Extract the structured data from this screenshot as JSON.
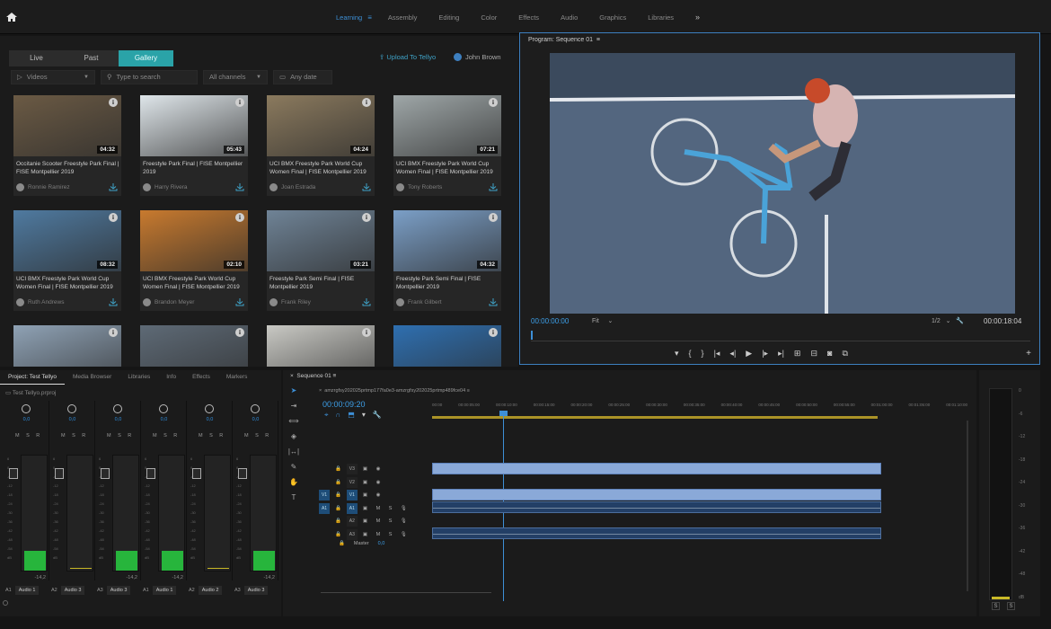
{
  "workspace_tabs": [
    {
      "label": "Learning",
      "active": true
    },
    {
      "label": "Assembly"
    },
    {
      "label": "Editing"
    },
    {
      "label": "Color"
    },
    {
      "label": "Effects"
    },
    {
      "label": "Audio"
    },
    {
      "label": "Graphics"
    },
    {
      "label": "Libraries"
    }
  ],
  "media": {
    "subtabs": [
      "Live",
      "Past",
      "Gallery"
    ],
    "active_subtab": "Gallery",
    "upload_label": "Upload To Tellyo",
    "user_name": "John Brown",
    "filters": {
      "type": "Videos",
      "search_placeholder": "Type to search",
      "channels": "All channels",
      "date": "Any date"
    },
    "cards": [
      {
        "title": "Occitanie Scooter Freestyle Park Final | FISE Montpellier 2019",
        "author": "Ronnie Ramirez",
        "duration": "04:32",
        "thumb": "#6b5a44"
      },
      {
        "title": "Freestyle Park Final | FISE Montpellier 2019",
        "author": "Harry Rivera",
        "duration": "05:43",
        "thumb": "#dfe6ea"
      },
      {
        "title": "UCI BMX Freestyle Park World Cup Women Final | FISE Montpellier 2019",
        "author": "Joan Estrada",
        "duration": "04:24",
        "thumb": "#8b7a5e"
      },
      {
        "title": "UCI BMX Freestyle Park World Cup Women Final | FISE Montpellier 2019",
        "author": "Tony Roberts",
        "duration": "07:21",
        "thumb": "#9fa7a8"
      },
      {
        "title": "UCI BMX Freestyle Park World Cup Women Final | FISE Montpellier 2019",
        "author": "Ruth Andrews",
        "duration": "08:32",
        "thumb": "#4f7aa0"
      },
      {
        "title": "UCI BMX Freestyle Park World Cup Women Final | FISE Montpellier 2019",
        "author": "Brandon Meyer",
        "duration": "02:10",
        "thumb": "#c87a2e"
      },
      {
        "title": "Freestyle Park Semi Final | FISE Montpellier 2019",
        "author": "Frank Riley",
        "duration": "03:21",
        "thumb": "#6f8396"
      },
      {
        "title": "Freestyle Park Semi Final | FISE Montpellier 2019",
        "author": "Frank Gilbert",
        "duration": "04:32",
        "thumb": "#7b9fc7"
      },
      {
        "title": "",
        "author": "",
        "duration": "",
        "thumb": "#8fa2b5"
      },
      {
        "title": "",
        "author": "",
        "duration": "",
        "thumb": "#5e6a76"
      },
      {
        "title": "",
        "author": "",
        "duration": "",
        "thumb": "#c9c9c4"
      },
      {
        "title": "",
        "author": "",
        "duration": "",
        "thumb": "#2e6fb0"
      }
    ]
  },
  "program": {
    "title": "Program: Sequence 01",
    "timecode_in": "00:00:00:00",
    "fit": "Fit",
    "resolution": "1/2",
    "timecode_out": "00:00:18:04",
    "frame_color": "#4f6580"
  },
  "bottom_tabs": [
    {
      "label": "Project: Test Tellyo",
      "active": true
    },
    {
      "label": "Media Browser"
    },
    {
      "label": "Libraries"
    },
    {
      "label": "Info"
    },
    {
      "label": "Effects"
    },
    {
      "label": "Markers"
    }
  ],
  "mixer": {
    "project_file": "Test Tellyo.prproj",
    "channels": [
      {
        "id": "A1",
        "name": "Audio 1",
        "db": "-14,2",
        "knob": "0,0"
      },
      {
        "id": "A2",
        "name": "Audio 3",
        "db": "",
        "knob": "0,0"
      },
      {
        "id": "A3",
        "name": "Audio 3",
        "db": "-14,2",
        "knob": "0,0"
      },
      {
        "id": "A1",
        "name": "Audio 1",
        "db": "-14,2",
        "knob": "0,0"
      },
      {
        "id": "A2",
        "name": "Audio 2",
        "db": "",
        "knob": "0,0"
      },
      {
        "id": "A3",
        "name": "Audio 3",
        "db": "-14,2",
        "knob": "0,0"
      }
    ],
    "scale": [
      "6",
      "0",
      "-6",
      "-12",
      "-18",
      "-24",
      "-30",
      "-36",
      "-42",
      "-48",
      "-54",
      "dB"
    ]
  },
  "timeline": {
    "tab": "Sequence 01",
    "sequence_name": "amzrgfsy202025prtmp177fa0e3-amzrgfsy202025prtmp489fce04",
    "timecode": "00:00:09:20",
    "ruler": [
      "00:00",
      "00:00:05:00",
      "00:00:10:00",
      "00:00:15:00",
      "00:00:20:00",
      "00:00:25:00",
      "00:00:30:00",
      "00:00:35:00",
      "00:00:40:00",
      "00:00:45:00",
      "00:00:50:00",
      "00:00:55:00",
      "00:01:00:00",
      "00:01:05:00",
      "00:01:10:00"
    ],
    "tracks": [
      {
        "src": "",
        "name": "V3",
        "type": "video"
      },
      {
        "src": "",
        "name": "V2",
        "type": "video"
      },
      {
        "src": "V1",
        "name": "V1",
        "type": "video"
      },
      {
        "src": "A1",
        "name": "A1",
        "type": "audio"
      },
      {
        "src": "",
        "name": "A2",
        "type": "audio"
      },
      {
        "src": "",
        "name": "A3",
        "type": "audio"
      }
    ],
    "master_label": "Master",
    "master_value": "0,0"
  },
  "meter": {
    "scale": [
      "0",
      "-6",
      "-12",
      "-18",
      "-24",
      "-30",
      "-36",
      "-42",
      "-48",
      "dB"
    ],
    "buttons": [
      "S",
      "S"
    ]
  }
}
